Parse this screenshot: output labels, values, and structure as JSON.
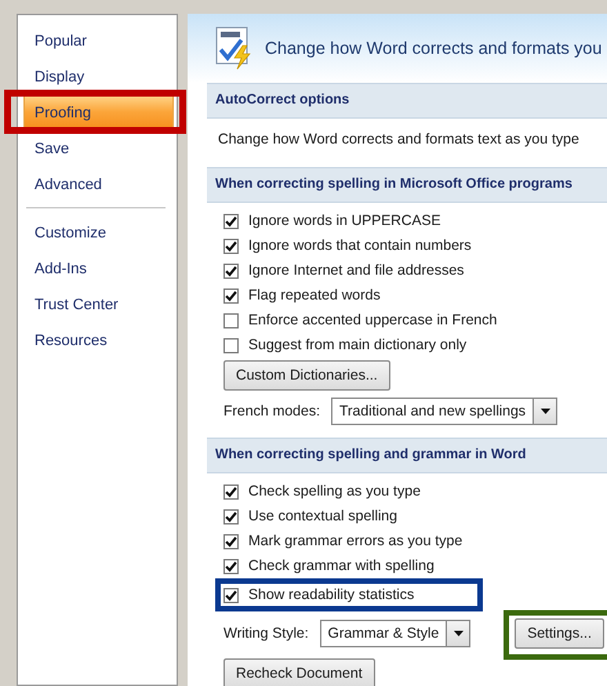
{
  "sidebar": {
    "groups": [
      [
        {
          "label": "Popular",
          "selected": false
        },
        {
          "label": "Display",
          "selected": false
        },
        {
          "label": "Proofing",
          "selected": true,
          "highlight": {
            "color": "#c00000"
          }
        },
        {
          "label": "Save",
          "selected": false
        },
        {
          "label": "Advanced",
          "selected": false
        }
      ],
      [
        {
          "label": "Customize",
          "selected": false
        },
        {
          "label": "Add-Ins",
          "selected": false
        },
        {
          "label": "Trust Center",
          "selected": false
        },
        {
          "label": "Resources",
          "selected": false
        }
      ]
    ]
  },
  "header": {
    "title": "Change how Word corrects and formats you"
  },
  "sections": [
    {
      "title": "AutoCorrect options",
      "rows": [
        {
          "kind": "text",
          "text": "Change how Word corrects and formats text as you type"
        }
      ]
    },
    {
      "title": "When correcting spelling in Microsoft Office programs",
      "rows": [
        {
          "kind": "checkbox",
          "label": "Ignore words in UPPERCASE",
          "checked": true
        },
        {
          "kind": "checkbox",
          "label": "Ignore words that contain numbers",
          "checked": true
        },
        {
          "kind": "checkbox",
          "label": "Ignore Internet and file addresses",
          "checked": true
        },
        {
          "kind": "checkbox",
          "label": "Flag repeated words",
          "checked": true
        },
        {
          "kind": "checkbox",
          "label": "Enforce accented uppercase in French",
          "checked": false
        },
        {
          "kind": "checkbox",
          "label": "Suggest from main dictionary only",
          "checked": false
        },
        {
          "kind": "button",
          "label": "Custom Dictionaries..."
        },
        {
          "kind": "dropdown",
          "label": "French modes:",
          "value": "Traditional and new spellings"
        }
      ]
    },
    {
      "title": "When correcting spelling and grammar in Word",
      "rows": [
        {
          "kind": "checkbox",
          "label": "Check spelling as you type",
          "checked": true
        },
        {
          "kind": "checkbox",
          "label": "Use contextual spelling",
          "checked": true
        },
        {
          "kind": "checkbox",
          "label": "Mark grammar errors as you type",
          "checked": true
        },
        {
          "kind": "checkbox",
          "label": "Check grammar with spelling",
          "checked": true
        },
        {
          "kind": "checkbox",
          "label": "Show readability statistics",
          "checked": true,
          "highlight": {
            "color": "#0b3990"
          }
        },
        {
          "kind": "dropdown",
          "label": "Writing Style:",
          "value": "Grammar & Style",
          "button": {
            "label": "Settings...",
            "highlight": {
              "color": "#3b6a0e"
            }
          }
        },
        {
          "kind": "button",
          "label": "Recheck Document"
        }
      ]
    }
  ]
}
